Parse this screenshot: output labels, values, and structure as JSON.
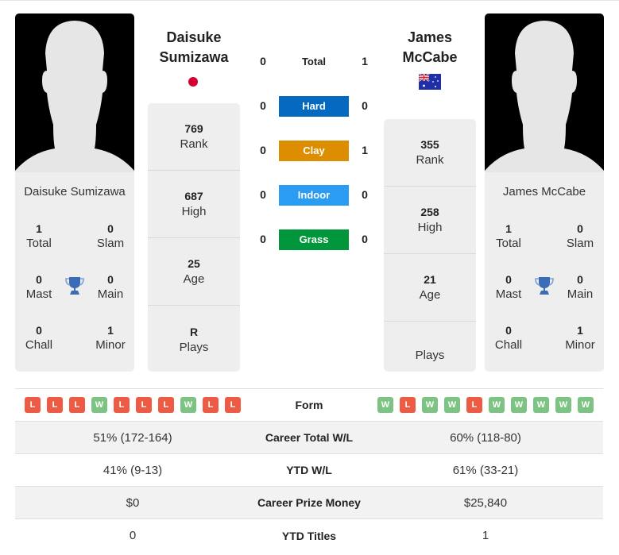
{
  "player1": {
    "name": "Daisuke Sumizawa",
    "name_line1": "Daisuke",
    "name_line2": "Sumizawa",
    "flag": "japan-flag",
    "titles": {
      "total": "1",
      "slam": "0",
      "mast": "0",
      "main": "0",
      "chall": "0",
      "minor": "1"
    },
    "stats": {
      "rank": "769",
      "high": "687",
      "age": "25",
      "plays": "R"
    },
    "form": [
      "L",
      "L",
      "L",
      "W",
      "L",
      "L",
      "L",
      "W",
      "L",
      "L"
    ],
    "career_total_wl": "51% (172-164)",
    "ytd_wl": "41% (9-13)",
    "career_prize_money": "$0",
    "ytd_titles": "0"
  },
  "player2": {
    "name": "James McCabe",
    "name_line1": "James",
    "name_line2": "McCabe",
    "flag": "australia-flag",
    "titles": {
      "total": "1",
      "slam": "0",
      "mast": "0",
      "main": "0",
      "chall": "0",
      "minor": "1"
    },
    "stats": {
      "rank": "355",
      "high": "258",
      "age": "21",
      "plays": ""
    },
    "form": [
      "W",
      "L",
      "W",
      "W",
      "L",
      "W",
      "W",
      "W",
      "W",
      "W"
    ],
    "career_total_wl": "60% (118-80)",
    "ytd_wl": "61% (33-21)",
    "career_prize_money": "$25,840",
    "ytd_titles": "1"
  },
  "labels": {
    "total": "Total",
    "slam": "Slam",
    "mast": "Mast",
    "main": "Main",
    "chall": "Chall",
    "minor": "Minor",
    "rank": "Rank",
    "high": "High",
    "age": "Age",
    "plays": "Plays",
    "form": "Form",
    "career_total_wl": "Career Total W/L",
    "ytd_wl": "YTD W/L",
    "career_prize_money": "Career Prize Money",
    "ytd_titles": "YTD Titles"
  },
  "h2h": [
    {
      "label": "Total",
      "p1": "0",
      "p2": "1",
      "color": ""
    },
    {
      "label": "Hard",
      "p1": "0",
      "p2": "0",
      "color": "#0469c0"
    },
    {
      "label": "Clay",
      "p1": "0",
      "p2": "1",
      "color": "#dc8d00"
    },
    {
      "label": "Indoor",
      "p1": "0",
      "p2": "0",
      "color": "#2a9cf2"
    },
    {
      "label": "Grass",
      "p1": "0",
      "p2": "0",
      "color": "#00963c"
    }
  ],
  "colors": {
    "win": "#7dc383",
    "loss": "#ee5b44",
    "trophy": "#3b6cb7"
  }
}
